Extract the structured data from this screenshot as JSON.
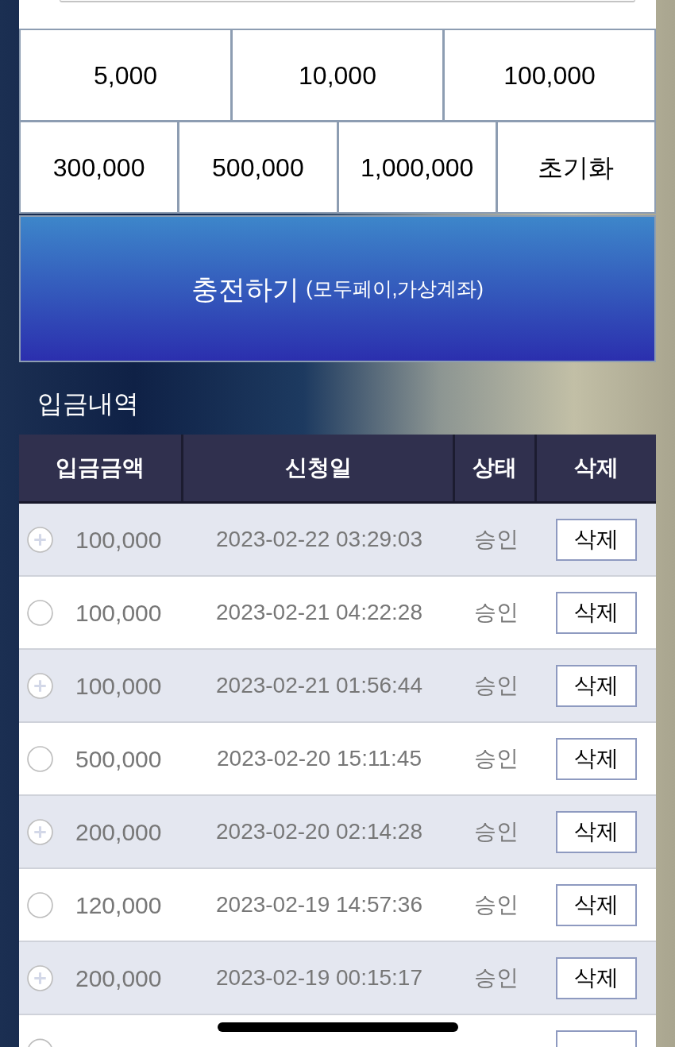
{
  "amount_buttons": [
    [
      "5,000",
      "10,000",
      "100,000"
    ],
    [
      "300,000",
      "500,000",
      "1,000,000",
      "초기화"
    ]
  ],
  "charge_button": {
    "label": "충전하기",
    "note": "(모두페이,가상계좌)"
  },
  "history": {
    "title": "입금내역",
    "columns": [
      "입금금액",
      "신청일",
      "상태",
      "삭제"
    ],
    "rows": [
      {
        "amount": "100,000",
        "date": "2023-02-22 03:29:03",
        "status": "승인",
        "action": "삭제"
      },
      {
        "amount": "100,000",
        "date": "2023-02-21 04:22:28",
        "status": "승인",
        "action": "삭제"
      },
      {
        "amount": "100,000",
        "date": "2023-02-21 01:56:44",
        "status": "승인",
        "action": "삭제"
      },
      {
        "amount": "500,000",
        "date": "2023-02-20 15:11:45",
        "status": "승인",
        "action": "삭제"
      },
      {
        "amount": "200,000",
        "date": "2023-02-20 02:14:28",
        "status": "승인",
        "action": "삭제"
      },
      {
        "amount": "120,000",
        "date": "2023-02-19 14:57:36",
        "status": "승인",
        "action": "삭제"
      },
      {
        "amount": "200,000",
        "date": "2023-02-19 00:15:17",
        "status": "승인",
        "action": "삭제"
      }
    ]
  }
}
